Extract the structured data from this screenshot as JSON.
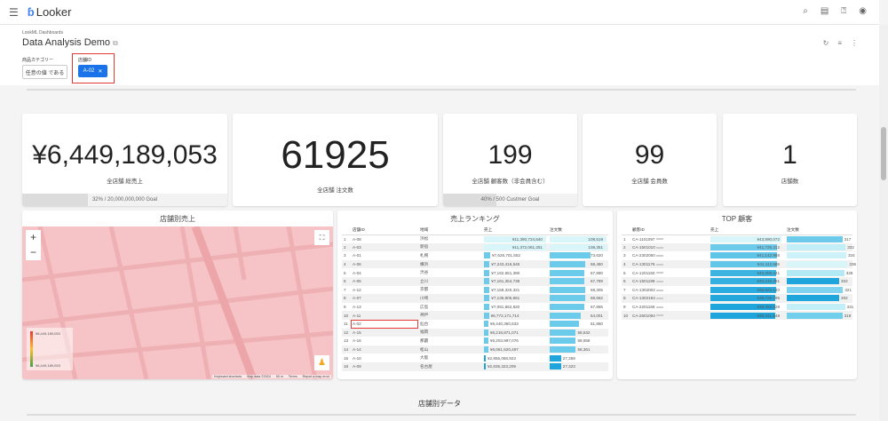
{
  "app": {
    "name": "Looker",
    "menu_icon": "menu-icon",
    "top_icons": [
      "search-icon",
      "marketplace-icon",
      "help-icon",
      "account-icon"
    ]
  },
  "header": {
    "breadcrumb": "LookML Dashboards",
    "title": "Data Analysis Demo",
    "filters": [
      {
        "label": "商品カテゴリー",
        "value": "任意の値 である"
      },
      {
        "label": "店舗ID",
        "value": "A-02"
      }
    ]
  },
  "kpis": [
    {
      "value": "¥6,449,189,053",
      "label": "全店舗 総売上",
      "goal": "32% / 20,000,000,000 Goal",
      "progress": 0.32
    },
    {
      "value": "61925",
      "label": "全店舗 注文数"
    },
    {
      "value": "199",
      "label": "全店舗 顧客数（非会員含む）",
      "goal": "40% / 500 Custmer Goal",
      "progress": 0.4
    },
    {
      "value": "99",
      "label": "全店舗 会員数"
    },
    {
      "value": "1",
      "label": "店舗数"
    }
  ],
  "map": {
    "title": "店舗別売上",
    "zoom_in": "+",
    "zoom_out": "−",
    "legend_max": "¥6,449,189,053",
    "legend_min": "¥6,449,189,053",
    "attribution": [
      "Keyboard shortcuts",
      "Map data ©2024",
      "50 m",
      "Terms",
      "Report a map error"
    ]
  },
  "ranking": {
    "title": "売上ランキング",
    "columns": [
      "店舗ID",
      "地域",
      "売上",
      "注文数"
    ],
    "rows": [
      [
        "1",
        "A-08",
        "浜松",
        "¥11,390,724,640",
        "108,519",
        1.0,
        1.0,
        "#d8f5fa"
      ],
      [
        "2",
        "A-03",
        "新宿",
        "¥11,372,061,251",
        "108,351",
        0.998,
        0.998,
        "#d8f5fa"
      ],
      [
        "3",
        "A-01",
        "札幌",
        "¥7,626,701,552",
        "73,620",
        0.1,
        0.72,
        "#6ccbea"
      ],
      [
        "4",
        "A-06",
        "横浜",
        "¥7,243,416,546",
        "68,460",
        0.09,
        0.62,
        "#6ccbea"
      ],
      [
        "5",
        "A-04",
        "渋谷",
        "¥7,162,651,390",
        "67,890",
        0.09,
        0.61,
        "#6ccbea"
      ],
      [
        "6",
        "A-05",
        "立川",
        "¥7,161,354,738",
        "67,789",
        0.09,
        0.61,
        "#6ccbea"
      ],
      [
        "7",
        "A-12",
        "京都",
        "¥7,158,320,321",
        "68,305",
        0.09,
        0.62,
        "#6ccbea"
      ],
      [
        "8",
        "A-07",
        "川崎",
        "¥7,136,905,861",
        "68,662",
        0.09,
        0.62,
        "#6ccbea"
      ],
      [
        "9",
        "A-13",
        "広島",
        "¥7,081,862,820",
        "67,855",
        0.09,
        0.61,
        "#6ccbea"
      ],
      [
        "10",
        "A-11",
        "神戸",
        "¥6,772,171,714",
        "64,001",
        0.08,
        0.55,
        "#6ccbea"
      ],
      [
        "11",
        "A-02",
        "仙台",
        "¥6,440,360,533",
        "61,860",
        0.07,
        0.52,
        "#6ccbea"
      ],
      [
        "12",
        "A-15",
        "福岡",
        "¥6,218,871,071",
        "58,532",
        0.07,
        0.46,
        "#6ccbea"
      ],
      [
        "13",
        "A-16",
        "那覇",
        "¥6,203,997,076",
        "58,658",
        0.07,
        0.46,
        "#6ccbea"
      ],
      [
        "14",
        "A-14",
        "松山",
        "¥6,061,520,497",
        "58,361",
        0.07,
        0.46,
        "#6ccbea"
      ],
      [
        "15",
        "A-10",
        "大阪",
        "¥2,855,058,923",
        "27,359",
        0.02,
        0.2,
        "#1ea5db"
      ],
      [
        "16",
        "A-09",
        "名古屋",
        "¥2,835,323,209",
        "27,323",
        0.02,
        0.2,
        "#1ea5db"
      ]
    ],
    "highlight_row": "11"
  },
  "top_customers": {
    "title": "TOP 顧客",
    "columns": [
      "顧客ID",
      "売上",
      "注文数"
    ],
    "rows": [
      [
        "1",
        "CA-1101097",
        "¥43,990,072",
        "317",
        0.97,
        "#d8f5fa",
        0.87,
        "#6ccbea"
      ],
      [
        "2",
        "CA-1501010",
        "¥41,725,312",
        "332",
        0.92,
        "#6ccbea",
        0.92,
        "#c2eef7"
      ],
      [
        "3",
        "CA-2302050",
        "¥41,142,958",
        "334",
        0.92,
        "#5fc5e8",
        0.93,
        "#cdf1f8"
      ],
      [
        "4",
        "CA-1301176",
        "¥41,112,586",
        "336",
        0.92,
        "#62c6e8",
        0.95,
        "#d8f5fa"
      ],
      [
        "5",
        "CA-1201150",
        "¥40,306,441",
        "328",
        0.9,
        "#3cb4e2",
        0.9,
        "#b3e9f5"
      ],
      [
        "6",
        "CA-1501198",
        "¥40,219,391",
        "302",
        0.9,
        "#33b0e0",
        0.82,
        "#1ea5db"
      ],
      [
        "7",
        "CA-1302002",
        "¥39,923,140",
        "321",
        0.9,
        "#2aace0",
        0.88,
        "#7fd3ee"
      ],
      [
        "8",
        "CA-1302194",
        "¥39,725,795",
        "302",
        0.89,
        "#23a8de",
        0.82,
        "#1ea5db"
      ],
      [
        "9",
        "CA-2201166",
        "¥39,483,028",
        "331",
        0.89,
        "#1ea5db",
        0.91,
        "#c2eef7"
      ],
      [
        "10",
        "CA-2601094",
        "¥39,421,548",
        "319",
        0.89,
        "#1ea5db",
        0.87,
        "#72cfec"
      ]
    ]
  },
  "section": {
    "title": "店舗別データ"
  }
}
